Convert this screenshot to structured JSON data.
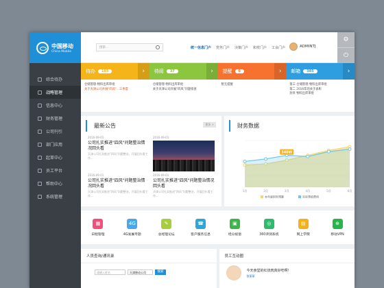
{
  "logo": {
    "cn": "中国移动",
    "en": "China Mobile"
  },
  "sidebar": {
    "items": [
      {
        "label": "综合待办",
        "active": false
      },
      {
        "label": "战略管理",
        "active": true
      },
      {
        "label": "信息中心",
        "active": false
      },
      {
        "label": "财务管理",
        "active": false
      },
      {
        "label": "公司刊引",
        "active": false
      },
      {
        "label": "部门应用",
        "active": false
      },
      {
        "label": "起草中心",
        "active": false
      },
      {
        "label": "员工平台",
        "active": false
      },
      {
        "label": "帮助中心",
        "active": false
      },
      {
        "label": "系统管理",
        "active": false
      }
    ]
  },
  "header": {
    "search_placeholder": "搜索...",
    "links": [
      "统一信息门户",
      "党务门户",
      "决策门户",
      "和校门户",
      "工会门户"
    ],
    "user": "ADMINTJ"
  },
  "cards": [
    {
      "label": "待办",
      "count": "185",
      "color": "#f4b41a",
      "lines": [
        "仓储管理-物料出库审批",
        "关于天津公司开展\"四风\"...三季度"
      ],
      "highlight": 1
    },
    {
      "label": "待阅",
      "count": "37",
      "color": "#8cc63f",
      "lines": [
        "仓储管理-物料出库审批",
        "关于天津公司开展\"四风\"问题排查"
      ],
      "highlight": -1
    },
    {
      "label": "提醒",
      "count": "6",
      "color": "#f7722e",
      "lines": [
        "暂无提醒"
      ],
      "highlight": -1
    },
    {
      "label": "邮箱",
      "count": "385",
      "color": "#2e9ee0",
      "lines": [
        "第三     仓储管理-物料出库审批",
        "第二     2016年的关于表彰",
        "封目     物料出库审批"
      ],
      "highlight": -1
    }
  ],
  "news": {
    "title": "最新公告",
    "more": "更多 >",
    "items": [
      {
        "date": "2016-09-01",
        "title": "公司扎实推进\"四风\"问题整治情况回头看",
        "summary": "天津公司扎实推进\"四风\"问题整治，开展回头看工作..."
      },
      {
        "date": "2016-09-01",
        "image": true
      },
      {
        "date": "2016-09-01",
        "title": "公司扎实推进\"四风\"问题整治情况回头看",
        "summary": "天津公司扎实推进\"四风\"问题整治，开展回头看工作..."
      },
      {
        "date": "2016-09-01",
        "title": "公司扎实推进\"四风\"问题整治情况回头看",
        "summary": "天津公司扎实推进\"四风\"问题整治，开展回头看工作..."
      }
    ]
  },
  "finance": {
    "title": "财务数据"
  },
  "chart_data": {
    "type": "area",
    "x": [
      "1月",
      "2月",
      "3月",
      "4月",
      "5月",
      "6月"
    ],
    "series": [
      {
        "name": "本年度财务预算",
        "values": [
          180,
          190,
          220,
          260,
          300,
          330
        ],
        "color": "#f7d567"
      },
      {
        "name": "实际预收费用",
        "values": [
          210,
          230,
          260,
          250,
          290,
          310
        ],
        "color": "#6ec6ec"
      }
    ],
    "callout": "340W",
    "ylim": [
      0,
      380
    ]
  },
  "apps": [
    {
      "label": "日程管理",
      "color": "#f14f7b",
      "glyph": "▦"
    },
    {
      "label": "4G发展专题",
      "color": "#49a9e6",
      "glyph": "4G"
    },
    {
      "label": "总经理论坛",
      "color": "#a6cf3d",
      "glyph": "✎"
    },
    {
      "label": "客户服务信息",
      "color": "#2fa5d8",
      "glyph": "☎"
    },
    {
      "label": "经分视窗",
      "color": "#3db54a",
      "glyph": "▣"
    },
    {
      "label": "360评测系统",
      "color": "#2fba6c",
      "glyph": "◎"
    },
    {
      "label": "网上学院",
      "color": "#f3b21a",
      "glyph": "▤"
    },
    {
      "label": "移动VPN",
      "color": "#2ab34a",
      "glyph": "⊕"
    }
  ],
  "bottom": {
    "query": {
      "title": "人员查询/通讯录",
      "placeholder": "请输入姓名",
      "select": "天津移动公司",
      "button": "搜索"
    },
    "interact": {
      "title": "员工互动圈",
      "quote": "今天食堂的红烧肉真好吃啊！",
      "name": "张丽丽"
    }
  }
}
